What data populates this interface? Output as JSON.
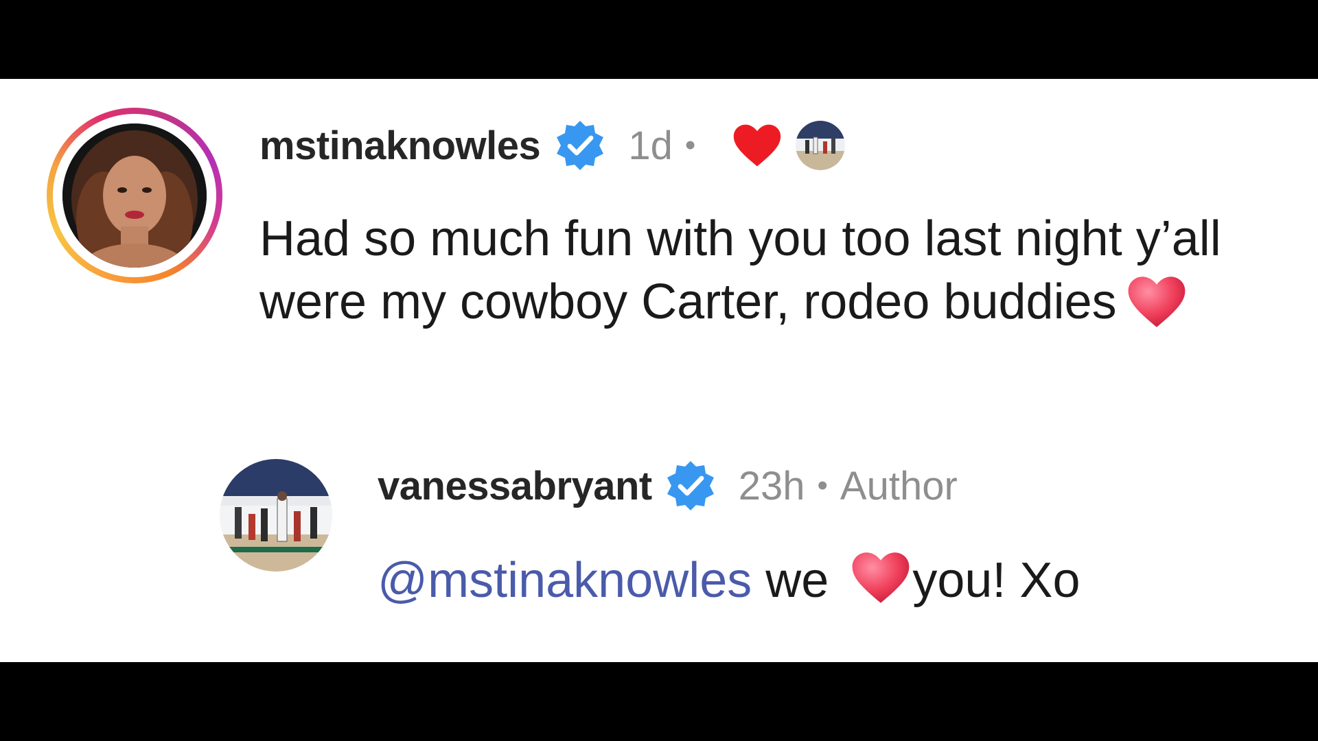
{
  "comment": {
    "username": "mstinaknowles",
    "verified": true,
    "time": "1d",
    "separator": "•",
    "liked_by_author": true,
    "text": "Had so much fun with you too last night y’all were my cowboy Carter, rodeo buddies",
    "emoji": "heart-emoji"
  },
  "reply": {
    "username": "vanessabryant",
    "verified": true,
    "time": "23h",
    "separator": "•",
    "badge": "Author",
    "mention": "@mstinaknowles",
    "text_before": " we ",
    "text_after": "you! Xo",
    "emoji": "heart-emoji"
  },
  "colors": {
    "verified_blue": "#3897f0",
    "like_red": "#ed1c24",
    "mention_blue": "#4a5bab",
    "meta_gray": "#8e8e8e",
    "text_dark": "#262626"
  },
  "icons": [
    "verified-badge-icon",
    "heart-icon",
    "heart-emoji"
  ]
}
